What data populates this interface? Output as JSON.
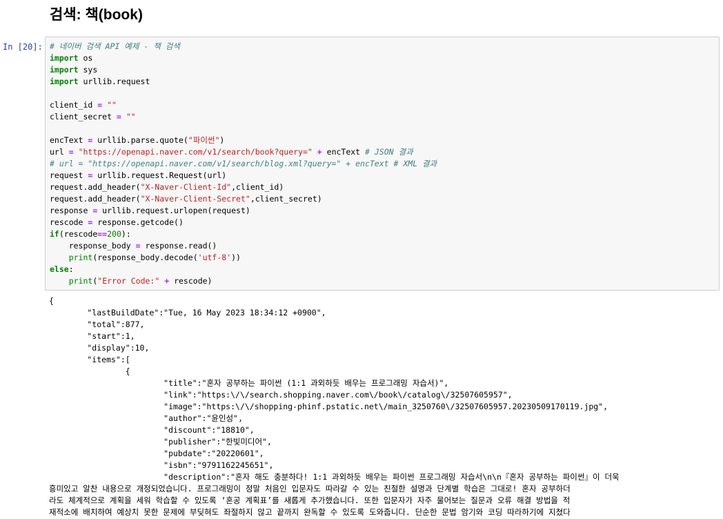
{
  "heading": "검색: 책(book)",
  "cell": {
    "prompt": "In [20]:",
    "code": [
      [
        {
          "t": "comment",
          "v": "# 네이버 검색 API 예제 - 책 검색"
        }
      ],
      [
        {
          "t": "kw",
          "v": "import"
        },
        {
          "t": "plain",
          "v": " os"
        }
      ],
      [
        {
          "t": "kw",
          "v": "import"
        },
        {
          "t": "plain",
          "v": " sys"
        }
      ],
      [
        {
          "t": "kw",
          "v": "import"
        },
        {
          "t": "plain",
          "v": " urllib.request"
        }
      ],
      [],
      [
        {
          "t": "plain",
          "v": "client_id "
        },
        {
          "t": "op",
          "v": "="
        },
        {
          "t": "plain",
          "v": " "
        },
        {
          "t": "str",
          "v": "\"\""
        }
      ],
      [
        {
          "t": "plain",
          "v": "client_secret "
        },
        {
          "t": "op",
          "v": "="
        },
        {
          "t": "plain",
          "v": " "
        },
        {
          "t": "str",
          "v": "\"\""
        }
      ],
      [],
      [
        {
          "t": "plain",
          "v": "encText "
        },
        {
          "t": "op",
          "v": "="
        },
        {
          "t": "plain",
          "v": " urllib.parse.quote("
        },
        {
          "t": "str",
          "v": "\"파이썬\""
        },
        {
          "t": "plain",
          "v": ")"
        }
      ],
      [
        {
          "t": "plain",
          "v": "url "
        },
        {
          "t": "op",
          "v": "="
        },
        {
          "t": "plain",
          "v": " "
        },
        {
          "t": "str",
          "v": "\"https://openapi.naver.com/v1/search/book?query=\""
        },
        {
          "t": "plain",
          "v": " "
        },
        {
          "t": "op",
          "v": "+"
        },
        {
          "t": "plain",
          "v": " encText "
        },
        {
          "t": "comment",
          "v": "# JSON 결과"
        }
      ],
      [
        {
          "t": "comment",
          "v": "# url = \"https://openapi.naver.com/v1/search/blog.xml?query=\" + encText # XML 결과"
        }
      ],
      [
        {
          "t": "plain",
          "v": "request "
        },
        {
          "t": "op",
          "v": "="
        },
        {
          "t": "plain",
          "v": " urllib.request.Request(url)"
        }
      ],
      [
        {
          "t": "plain",
          "v": "request.add_header("
        },
        {
          "t": "str",
          "v": "\"X-Naver-Client-Id\""
        },
        {
          "t": "plain",
          "v": ",client_id)"
        }
      ],
      [
        {
          "t": "plain",
          "v": "request.add_header("
        },
        {
          "t": "str",
          "v": "\"X-Naver-Client-Secret\""
        },
        {
          "t": "plain",
          "v": ",client_secret)"
        }
      ],
      [
        {
          "t": "plain",
          "v": "response "
        },
        {
          "t": "op",
          "v": "="
        },
        {
          "t": "plain",
          "v": " urllib.request.urlopen(request)"
        }
      ],
      [
        {
          "t": "plain",
          "v": "rescode "
        },
        {
          "t": "op",
          "v": "="
        },
        {
          "t": "plain",
          "v": " response.getcode()"
        }
      ],
      [
        {
          "t": "kw",
          "v": "if"
        },
        {
          "t": "plain",
          "v": "(rescode"
        },
        {
          "t": "op",
          "v": "=="
        },
        {
          "t": "num",
          "v": "200"
        },
        {
          "t": "plain",
          "v": "):"
        }
      ],
      [
        {
          "t": "plain",
          "v": "    response_body "
        },
        {
          "t": "op",
          "v": "="
        },
        {
          "t": "plain",
          "v": " response.read()"
        }
      ],
      [
        {
          "t": "plain",
          "v": "    "
        },
        {
          "t": "bi",
          "v": "print"
        },
        {
          "t": "plain",
          "v": "(response_body.decode("
        },
        {
          "t": "str",
          "v": "'utf-8'"
        },
        {
          "t": "plain",
          "v": "))"
        }
      ],
      [
        {
          "t": "kw",
          "v": "else"
        },
        {
          "t": "plain",
          "v": ":"
        }
      ],
      [
        {
          "t": "plain",
          "v": "    "
        },
        {
          "t": "bi",
          "v": "print"
        },
        {
          "t": "plain",
          "v": "("
        },
        {
          "t": "str",
          "v": "\"Error Code:\""
        },
        {
          "t": "plain",
          "v": " "
        },
        {
          "t": "op",
          "v": "+"
        },
        {
          "t": "plain",
          "v": " rescode)"
        }
      ]
    ],
    "output": [
      "{",
      "\t\"lastBuildDate\":\"Tue, 16 May 2023 18:34:12 +0900\",",
      "\t\"total\":877,",
      "\t\"start\":1,",
      "\t\"display\":10,",
      "\t\"items\":[",
      "\t\t{",
      "\t\t\t\"title\":\"혼자 공부하는 파이썬 (1:1 과외하듯 배우는 프로그래밍 자습서)\",",
      "\t\t\t\"link\":\"https:\\/\\/search.shopping.naver.com\\/book\\/catalog\\/32507605957\",",
      "\t\t\t\"image\":\"https:\\/\\/shopping-phinf.pstatic.net\\/main_3250760\\/32507605957.20230509170119.jpg\",",
      "\t\t\t\"author\":\"윤인성\",",
      "\t\t\t\"discount\":\"18810\",",
      "\t\t\t\"publisher\":\"한빛미디어\",",
      "\t\t\t\"pubdate\":\"20220601\",",
      "\t\t\t\"isbn\":\"9791162245651\",",
      "\t\t\t\"description\":\"혼자 해도 충분하다! 1:1 과외하듯 배우는 파이썬 프로그래밍 자습서\\n\\n『혼자 공부하는 파이썬』이 더욱",
      "흥미있고 알찬 내용으로 개정되었습니다. 프로그래밍이 정말 처음인 입문자도 따라갈 수 있는 친절한 설명과 단계별 학습은 그대로! 혼자 공부하더",
      "라도 체계적으로 계획을 세워 학습할 수 있도록 ‘혼공 계획표’를 새롭게 추가했습니다. 또한 입문자가 자주 물어보는 질문과 오류 해결 방법을 적",
      "재적소에 배치하여 예상치 못한 문제에 부딪혀도 좌절하지 않고 끝까지 완독할 수 있도록 도와줍니다. 단순한 문법 암기와 코딩 따라하기에 지쳤다"
    ]
  }
}
